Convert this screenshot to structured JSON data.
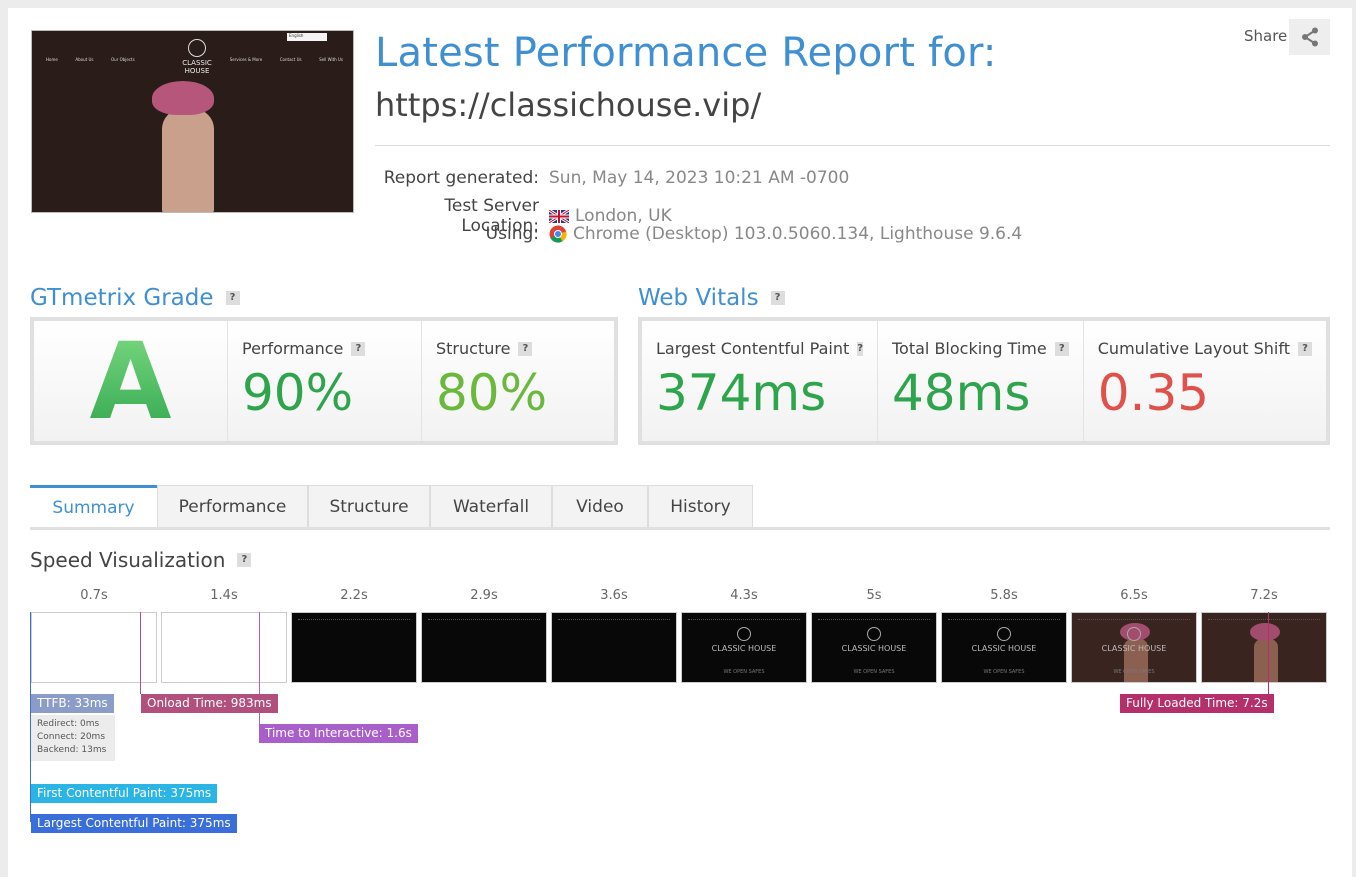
{
  "header": {
    "title": "Latest Performance Report for:",
    "url": "https://classichouse.vip/",
    "share_label": "Share",
    "thumbnail": {
      "brand": "CLASSIC HOUSE",
      "nav": [
        "Home",
        "About Us",
        "Our Objects",
        "Services & More",
        "Contact Us",
        "Sell With Us"
      ],
      "lang": "English"
    },
    "meta": [
      {
        "key": "Report generated:",
        "value": "Sun, May 14, 2023 10:21 AM -0700",
        "icon": ""
      },
      {
        "key": "Test Server Location:",
        "value": "London, UK",
        "icon": "uk-flag-icon"
      },
      {
        "key": "Using:",
        "value": "Chrome (Desktop) 103.0.5060.134, Lighthouse 9.6.4",
        "icon": "chrome-icon"
      }
    ]
  },
  "grade": {
    "heading": "GTmetrix Grade",
    "letter": "A",
    "performance": {
      "label": "Performance",
      "value": "90%"
    },
    "structure": {
      "label": "Structure",
      "value": "80%"
    }
  },
  "vitals": {
    "heading": "Web Vitals",
    "lcp": {
      "label": "Largest Contentful Paint",
      "value": "374ms"
    },
    "tbt": {
      "label": "Total Blocking Time",
      "value": "48ms"
    },
    "cls": {
      "label": "Cumulative Layout Shift",
      "value": "0.35"
    }
  },
  "tabs": [
    "Summary",
    "Performance",
    "Structure",
    "Waterfall",
    "Video",
    "History"
  ],
  "speed": {
    "heading": "Speed Visualization",
    "ticks": [
      "0.7s",
      "1.4s",
      "2.2s",
      "2.9s",
      "3.6s",
      "4.3s",
      "5s",
      "5.8s",
      "6.5s",
      "7.2s"
    ],
    "frame_brand": "CLASSIC HOUSE",
    "frame_sub": "WE OPEN SAFES",
    "markers": {
      "ttfb": "TTFB: 33ms",
      "ttfb_detail": [
        "Redirect: 0ms",
        "Connect: 20ms",
        "Backend: 13ms"
      ],
      "onload": "Onload Time: 983ms",
      "tti": "Time to Interactive: 1.6s",
      "fcp": "First Contentful Paint: 375ms",
      "lcp": "Largest Contentful Paint: 375ms",
      "fully_loaded": "Fully Loaded Time: 7.2s"
    }
  },
  "colors": {
    "accent": "#3f8fd2",
    "good": "#2ea44d",
    "ok": "#6ab83c",
    "bad": "#e0514b",
    "ttfb": "#8a9cc7",
    "onload": "#b1507c",
    "tti": "#a95fc9",
    "fcp": "#2bb5e4",
    "lcp": "#3a6ed8",
    "fully": "#b5306b"
  }
}
